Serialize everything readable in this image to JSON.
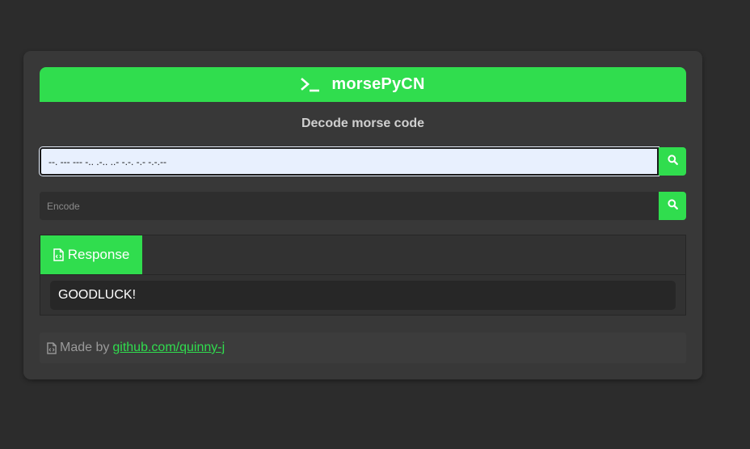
{
  "header": {
    "title": "morsePyCN",
    "icon": "terminal-icon"
  },
  "subtitle": "Decode morse code",
  "decode": {
    "value": "--. --- --- -.. .-.. ..- -.-. -.- -.-.--",
    "button_icon": "search-icon"
  },
  "encode": {
    "value": "",
    "placeholder": "Encode",
    "button_icon": "search-icon"
  },
  "response": {
    "tab_label": "Response",
    "tab_icon": "file-code-icon",
    "output": "GOODLUCK!"
  },
  "footer": {
    "prefix": "Made by",
    "link_text": "github.com/quinny-j",
    "icon": "file-code-icon"
  },
  "colors": {
    "accent": "#30dd4e",
    "background": "#2c2c2c",
    "card": "#383838"
  }
}
